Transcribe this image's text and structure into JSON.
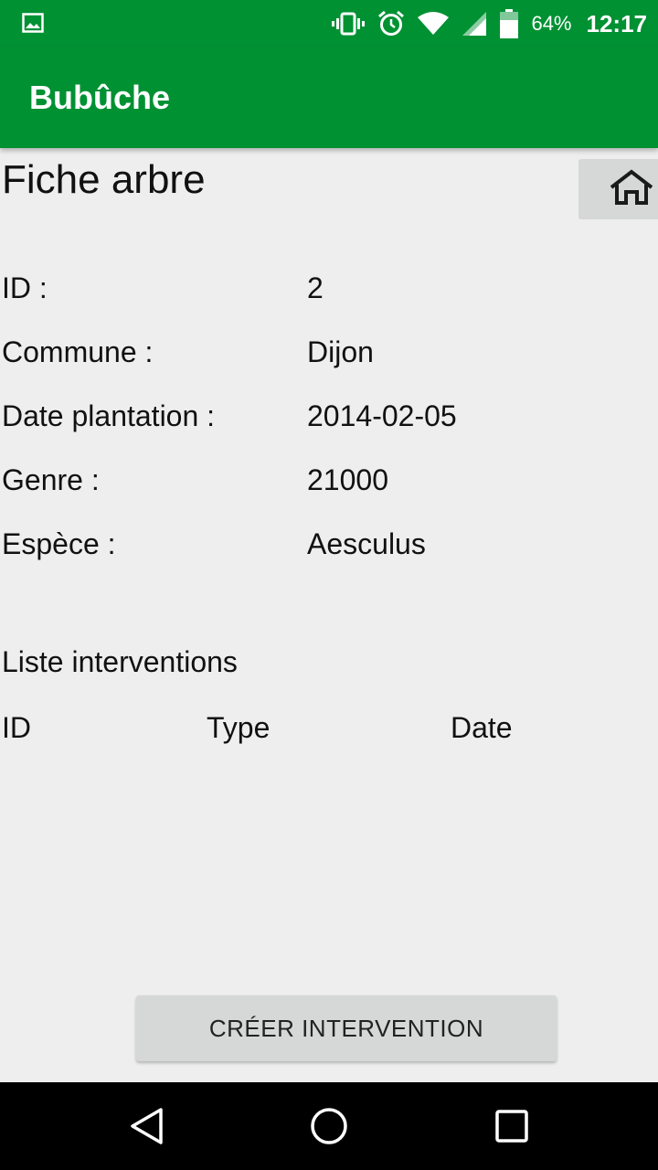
{
  "status_bar": {
    "battery_percent": "64%",
    "time": "12:17",
    "icons": [
      "image-icon",
      "vibrate-icon",
      "alarm-icon",
      "wifi-icon",
      "signal-icon",
      "battery-icon"
    ]
  },
  "app_bar": {
    "title": "Bubûche"
  },
  "page": {
    "title": "Fiche arbre",
    "home_icon": "home-icon"
  },
  "fields": [
    {
      "label": "ID :",
      "value": "2"
    },
    {
      "label": "Commune :",
      "value": "Dijon"
    },
    {
      "label": "Date plantation :",
      "value": "2014-02-05"
    },
    {
      "label": "Genre :",
      "value": "21000"
    },
    {
      "label": "Espèce :",
      "value": "Aesculus"
    }
  ],
  "interventions": {
    "title": "Liste interventions",
    "columns": [
      "ID",
      "Type",
      "Date"
    ],
    "rows": []
  },
  "actions": {
    "create_label": "CRÉER INTERVENTION"
  },
  "nav_bar": {
    "icons": [
      "back-icon",
      "home-circle-icon",
      "recents-icon"
    ]
  },
  "colors": {
    "primary": "#009133",
    "background": "#eeeeee",
    "button": "#d6d7d7"
  }
}
